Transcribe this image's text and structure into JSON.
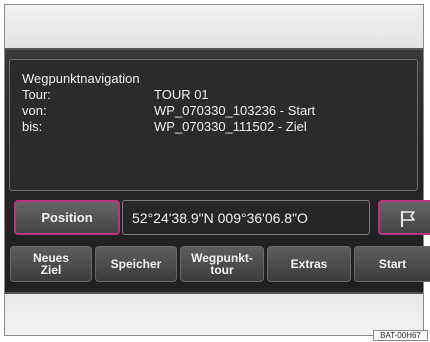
{
  "info": {
    "title": "Wegpunktnavigation",
    "rows": [
      {
        "label": "Tour:",
        "value": "TOUR 01"
      },
      {
        "label": "von:",
        "value": "WP_070330_103236 - Start"
      },
      {
        "label": "bis:",
        "value": "WP_070330_111502 - Ziel"
      }
    ]
  },
  "position": {
    "button_label": "Position",
    "coordinates": "52°24'38.9\"N 009°36'06.8\"O"
  },
  "softkeys": [
    {
      "label": "Neues\nZiel"
    },
    {
      "label": "Speicher"
    },
    {
      "label": "Wegpunkt-\ntour"
    },
    {
      "label": "Extras"
    },
    {
      "label": "Start"
    }
  ],
  "flag_icon": "flag-icon",
  "accent_color": "#c0307e",
  "image_code": "BAT-00H67"
}
